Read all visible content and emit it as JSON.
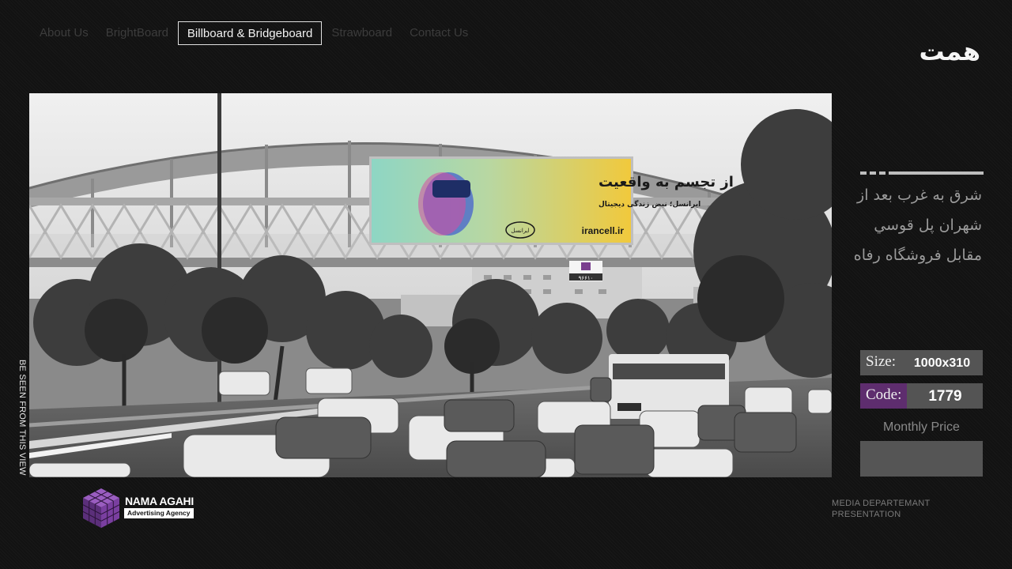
{
  "nav": [
    {
      "label": "About Us",
      "active": false
    },
    {
      "label": "BrightBoard",
      "active": false
    },
    {
      "label": "Billboard & Bridgeboard",
      "active": true
    },
    {
      "label": "Strawboard",
      "active": false
    },
    {
      "label": "Contact Us",
      "active": false
    }
  ],
  "photo": {
    "vertical_caption": "BE SEEN FROM THIS VIEW",
    "billboard_headline": "از تجسم به واقعیت",
    "billboard_subline": "ایرانسل؛ نبض زندگی دیجیتال",
    "billboard_url": "irancell.ir",
    "billboard_brand": "ایرانسل",
    "sign_number": "۹۶۶۱۰"
  },
  "location": {
    "title": "همت",
    "address_lines": [
      "شرق به غرب بعد از",
      "شهران پل قوسي",
      "مقابل فروشگاه رفاه"
    ]
  },
  "specs": {
    "size_label": "Size:",
    "size_value": "1000x310",
    "code_label": "Code:",
    "code_value": "1779",
    "price_label": "Monthly Price",
    "price_value": ""
  },
  "logo": {
    "name": "NAMA AGAHI",
    "tagline": "Advertising Agency"
  },
  "footer": {
    "line1": "MEDIA DEPARTEMANT",
    "line2": "PRESENTATION"
  },
  "colors": {
    "background": "#121212",
    "accent_purple": "#5e2d6e",
    "value_box": "#545454"
  }
}
